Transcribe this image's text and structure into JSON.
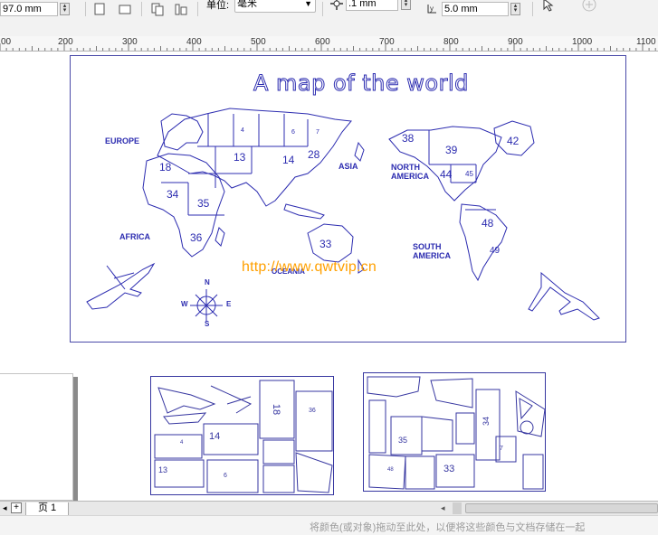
{
  "propbar": {
    "width_value": "97.0 mm",
    "unit_label": "单位:",
    "unit_value": "毫米",
    "nudge_value": ".1 mm",
    "duplicate_value": "5.0 mm"
  },
  "ruler": {
    "ticks": [
      "00",
      "200",
      "300",
      "400",
      "500",
      "600",
      "700",
      "800",
      "900",
      "1000",
      "1100"
    ]
  },
  "map": {
    "title": "A map of the world",
    "continents": [
      "EUROPE",
      "ASIA",
      "NORTH AMERICA",
      "AFRICA",
      "SOUTH AMERICA",
      "OCEANIA"
    ],
    "north_america_line1": "NORTH",
    "north_america_line2": "AMERICA",
    "south_america_line1": "SOUTH",
    "south_america_line2": "AMERICA",
    "piece_numbers": [
      "4",
      "6",
      "7",
      "13",
      "14",
      "28",
      "18",
      "34",
      "35",
      "36",
      "33",
      "38",
      "39",
      "42",
      "44",
      "45",
      "48",
      "49"
    ],
    "compass": {
      "n": "N",
      "s": "S",
      "e": "E",
      "w": "W"
    }
  },
  "watermark": "http://www.qwtvip.cn",
  "sheet1": {
    "labels": [
      "14",
      "13",
      "6",
      "4",
      "18",
      "36"
    ]
  },
  "sheet2": {
    "labels": [
      "35",
      "33",
      "34",
      "48",
      "7"
    ]
  },
  "page_tab": "页 1",
  "status_hint": "将颜色(或对象)拖动至此处，以便将这些颜色与文档存储在一起"
}
